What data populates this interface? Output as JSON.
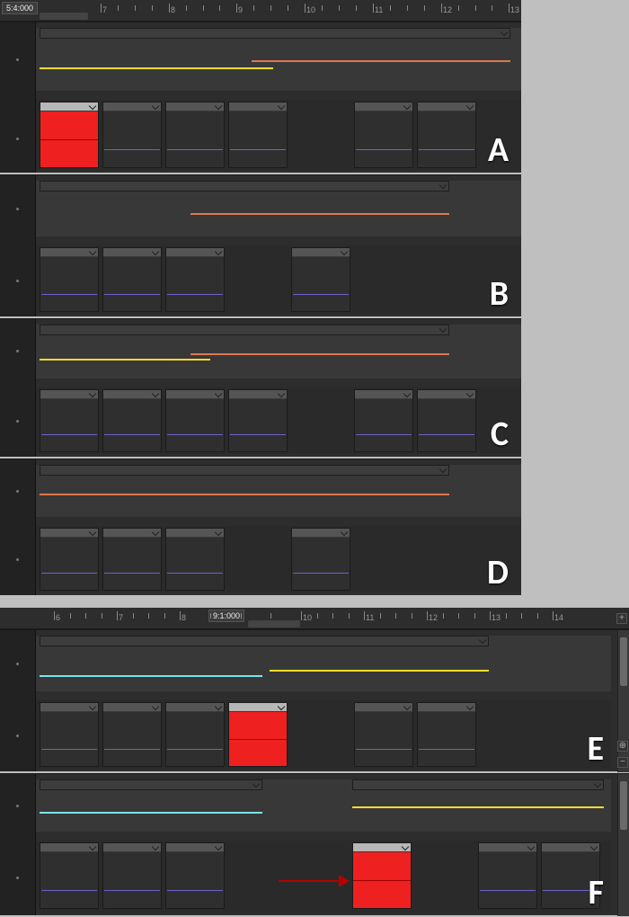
{
  "section1": {
    "ruler": {
      "position_text": "5:4:000",
      "tick_labels": [
        "7",
        "8",
        "9",
        "10",
        "11",
        "12",
        "13"
      ],
      "tick_x": [
        112,
        188,
        263,
        339,
        415,
        491,
        566
      ]
    }
  },
  "section2": {
    "ruler": {
      "position_text": "9:1:000",
      "tick_labels": [
        "6",
        "7",
        "8",
        "10",
        "11",
        "12",
        "13",
        "14"
      ],
      "tick_x": [
        60,
        130,
        200,
        335,
        405,
        475,
        545,
        615
      ]
    }
  },
  "panels": {
    "A": {
      "label": "A"
    },
    "B": {
      "label": "B"
    },
    "C": {
      "label": "C"
    },
    "D": {
      "label": "D"
    },
    "E": {
      "label": "E"
    },
    "F": {
      "label": "F"
    }
  },
  "buttons": {
    "plus": "+",
    "minus": "−"
  }
}
